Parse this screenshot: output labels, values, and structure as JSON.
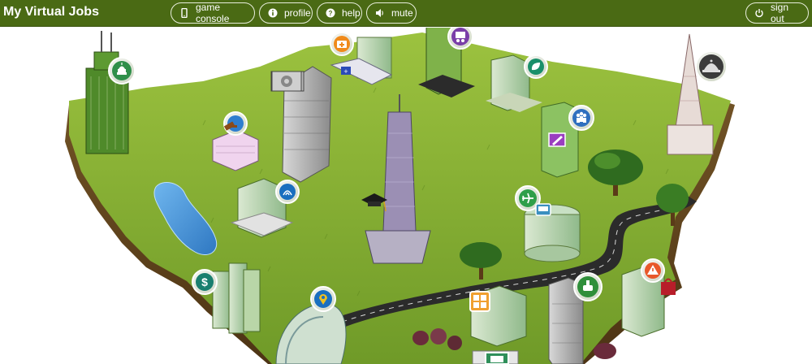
{
  "app": {
    "title": "My Virtual Jobs"
  },
  "nav": {
    "game_console": "game console",
    "profile": "profile",
    "help": "help",
    "mute": "mute",
    "sign_out": "sign out"
  },
  "icons": {
    "game_console": "tablet-icon",
    "profile": "info-icon",
    "help": "question-icon",
    "mute": "speaker-icon",
    "sign_out": "power-icon"
  },
  "colors": {
    "topbar": "#4a6a14",
    "grass": "#7ea832",
    "road": "#2b2b2b",
    "water": "#3f8fd6"
  }
}
